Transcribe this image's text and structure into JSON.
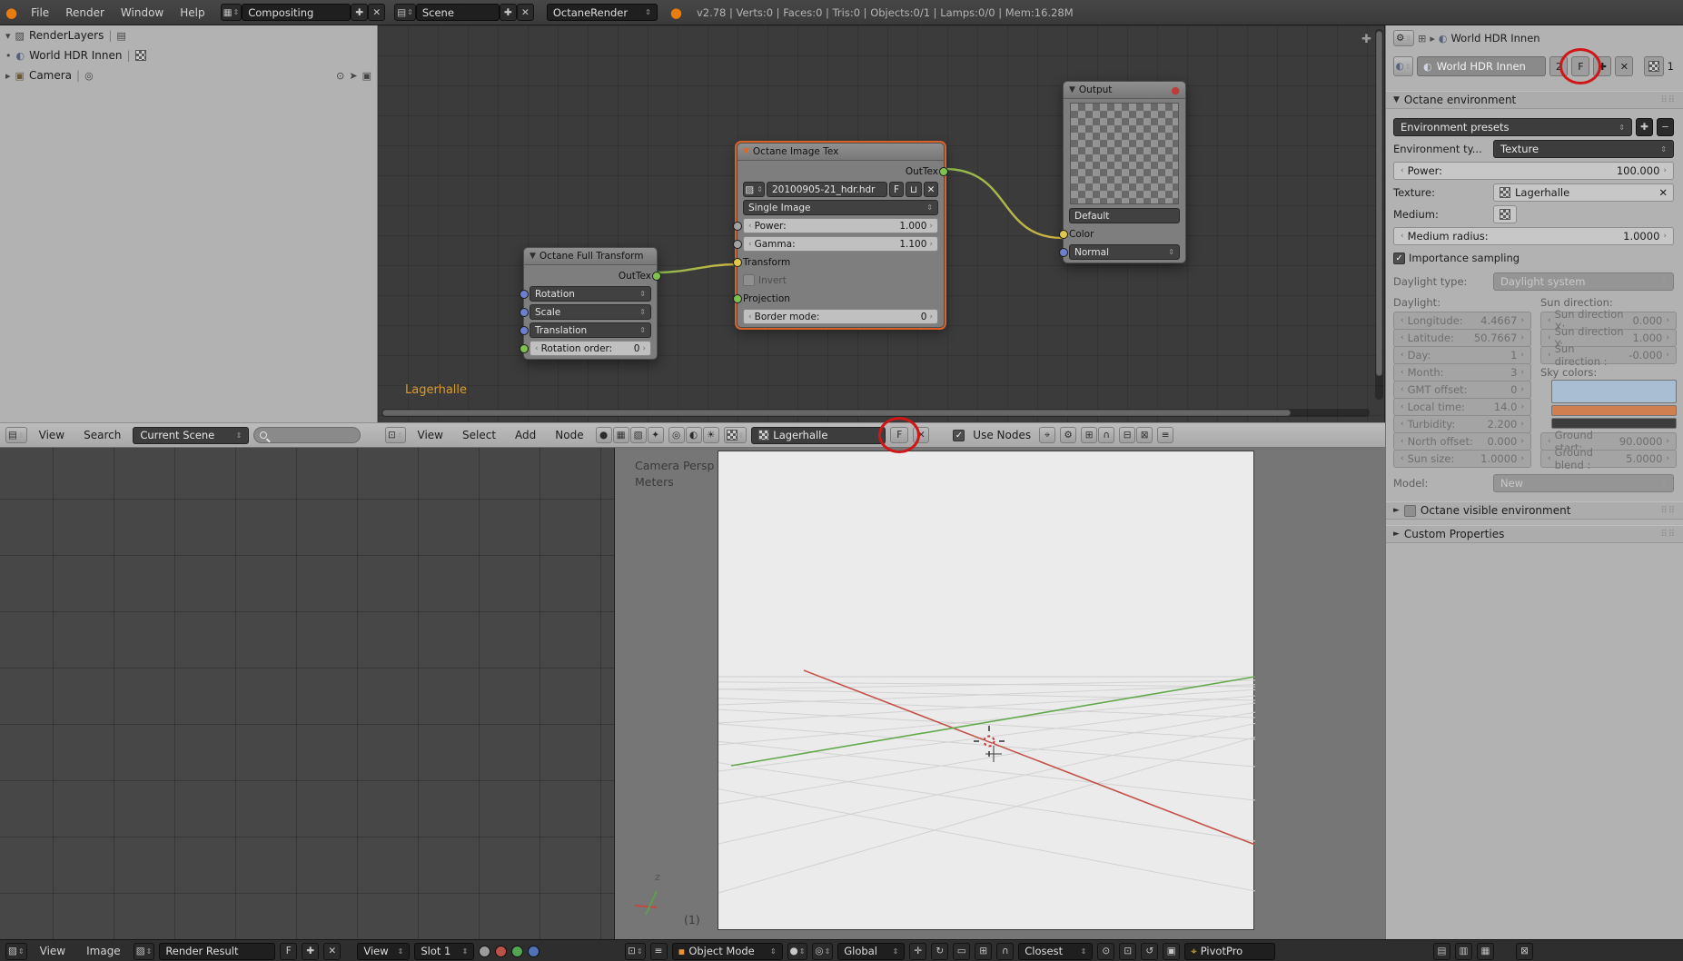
{
  "topbar": {
    "menus": [
      "File",
      "Render",
      "Window",
      "Help"
    ],
    "layout": "Compositing",
    "scene": "Scene",
    "engine": "OctaneRender",
    "stats": "v2.78 | Verts:0 | Faces:0 | Tris:0 | Objects:0/1 | Lamps:0/0 | Mem:16.28M"
  },
  "outliner": {
    "rows": [
      {
        "label": "RenderLayers"
      },
      {
        "label": "World HDR Innen"
      },
      {
        "label": "Camera"
      }
    ],
    "header": {
      "menus": [
        "View",
        "Search"
      ],
      "scene": "Current Scene"
    }
  },
  "node_editor": {
    "tree_label": "Lagerhalle",
    "transform_node": {
      "title": "Octane Full Transform",
      "output": "OutTex",
      "options": [
        "Rotation",
        "Scale",
        "Translation"
      ],
      "rotation_order_label": "Rotation order:",
      "rotation_order_value": "0"
    },
    "image_node": {
      "title": "Octane Image Tex",
      "output": "OutTex",
      "filename": "20100905-21_hdr.hdr",
      "fake_user": "F",
      "source_mode": "Single Image",
      "power_label": "Power:",
      "power_value": "1.000",
      "gamma_label": "Gamma:",
      "gamma_value": "1.100",
      "transform_label": "Transform",
      "invert_label": "Invert",
      "projection_label": "Projection",
      "border_label": "Border mode:",
      "border_value": "0"
    },
    "output_node": {
      "title": "Output",
      "default_label": "Default",
      "color_label": "Color",
      "normal_label": "Normal"
    },
    "header": {
      "menus": [
        "View",
        "Select",
        "Add",
        "Node"
      ],
      "tree_name": "Lagerhalle",
      "fake_user": "F",
      "use_nodes": "Use Nodes"
    }
  },
  "image_editor": {
    "menus": [
      "View",
      "Image"
    ],
    "datablock": "Render Result",
    "fake_user": "F",
    "view_label": "View",
    "slot": "Slot 1"
  },
  "viewport": {
    "view_label": "Camera Persp",
    "unit_label": "Meters",
    "frame_label": "(1)",
    "gizmo_z": "z",
    "header": {
      "mode": "Object Mode",
      "orientation": "Global",
      "snap_target": "Closest",
      "addon_button": "PivotPro"
    }
  },
  "properties": {
    "breadcrumb": "World HDR Innen",
    "datablock": {
      "name": "World HDR Innen",
      "users": "2",
      "fake_user": "F",
      "tex_count": "1"
    },
    "env_panel": "Octane environment",
    "presets": "Environment presets",
    "env_type_label": "Environment ty...",
    "env_type": "Texture",
    "power_label": "Power:",
    "power_value": "100.000",
    "texture_label": "Texture:",
    "texture_name": "Lagerhalle",
    "medium_label": "Medium:",
    "radius_label": "Medium radius:",
    "radius_value": "1.0000",
    "importance_label": "Importance sampling",
    "daylight_type_label": "Daylight type:",
    "daylight_type": "Daylight system",
    "daylight_col": "Daylight:",
    "sun_col": "Sun direction:",
    "left": [
      {
        "label": "Longitude:",
        "value": "4.4667"
      },
      {
        "label": "Latitude:",
        "value": "50.7667"
      },
      {
        "label": "Day:",
        "value": "1"
      },
      {
        "label": "Month:",
        "value": "3"
      },
      {
        "label": "GMT offset:",
        "value": "0"
      },
      {
        "label": "Local time:",
        "value": "14.0"
      },
      {
        "label": "Turbidity:",
        "value": "2.200"
      },
      {
        "label": "North offset:",
        "value": "0.000"
      },
      {
        "label": "Sun size:",
        "value": "1.0000"
      }
    ],
    "right": [
      {
        "label": "Sun direction X:",
        "value": "0.000"
      },
      {
        "label": "Sun direction Y:",
        "value": "1.000"
      },
      {
        "label": "Sun direction :",
        "value": "-0.000"
      }
    ],
    "sky_label": "Sky colors:",
    "sky_colors": [
      "#a9bdd3",
      "#cf7f50",
      "#3d3d3d"
    ],
    "ground": [
      {
        "label": "Ground start:",
        "value": "90.0000"
      },
      {
        "label": "Ground blend :",
        "value": "5.0000"
      }
    ],
    "model_label": "Model:",
    "model_value": "New",
    "visible_env_panel": "Octane visible environment",
    "custom_props_panel": "Custom Properties"
  }
}
